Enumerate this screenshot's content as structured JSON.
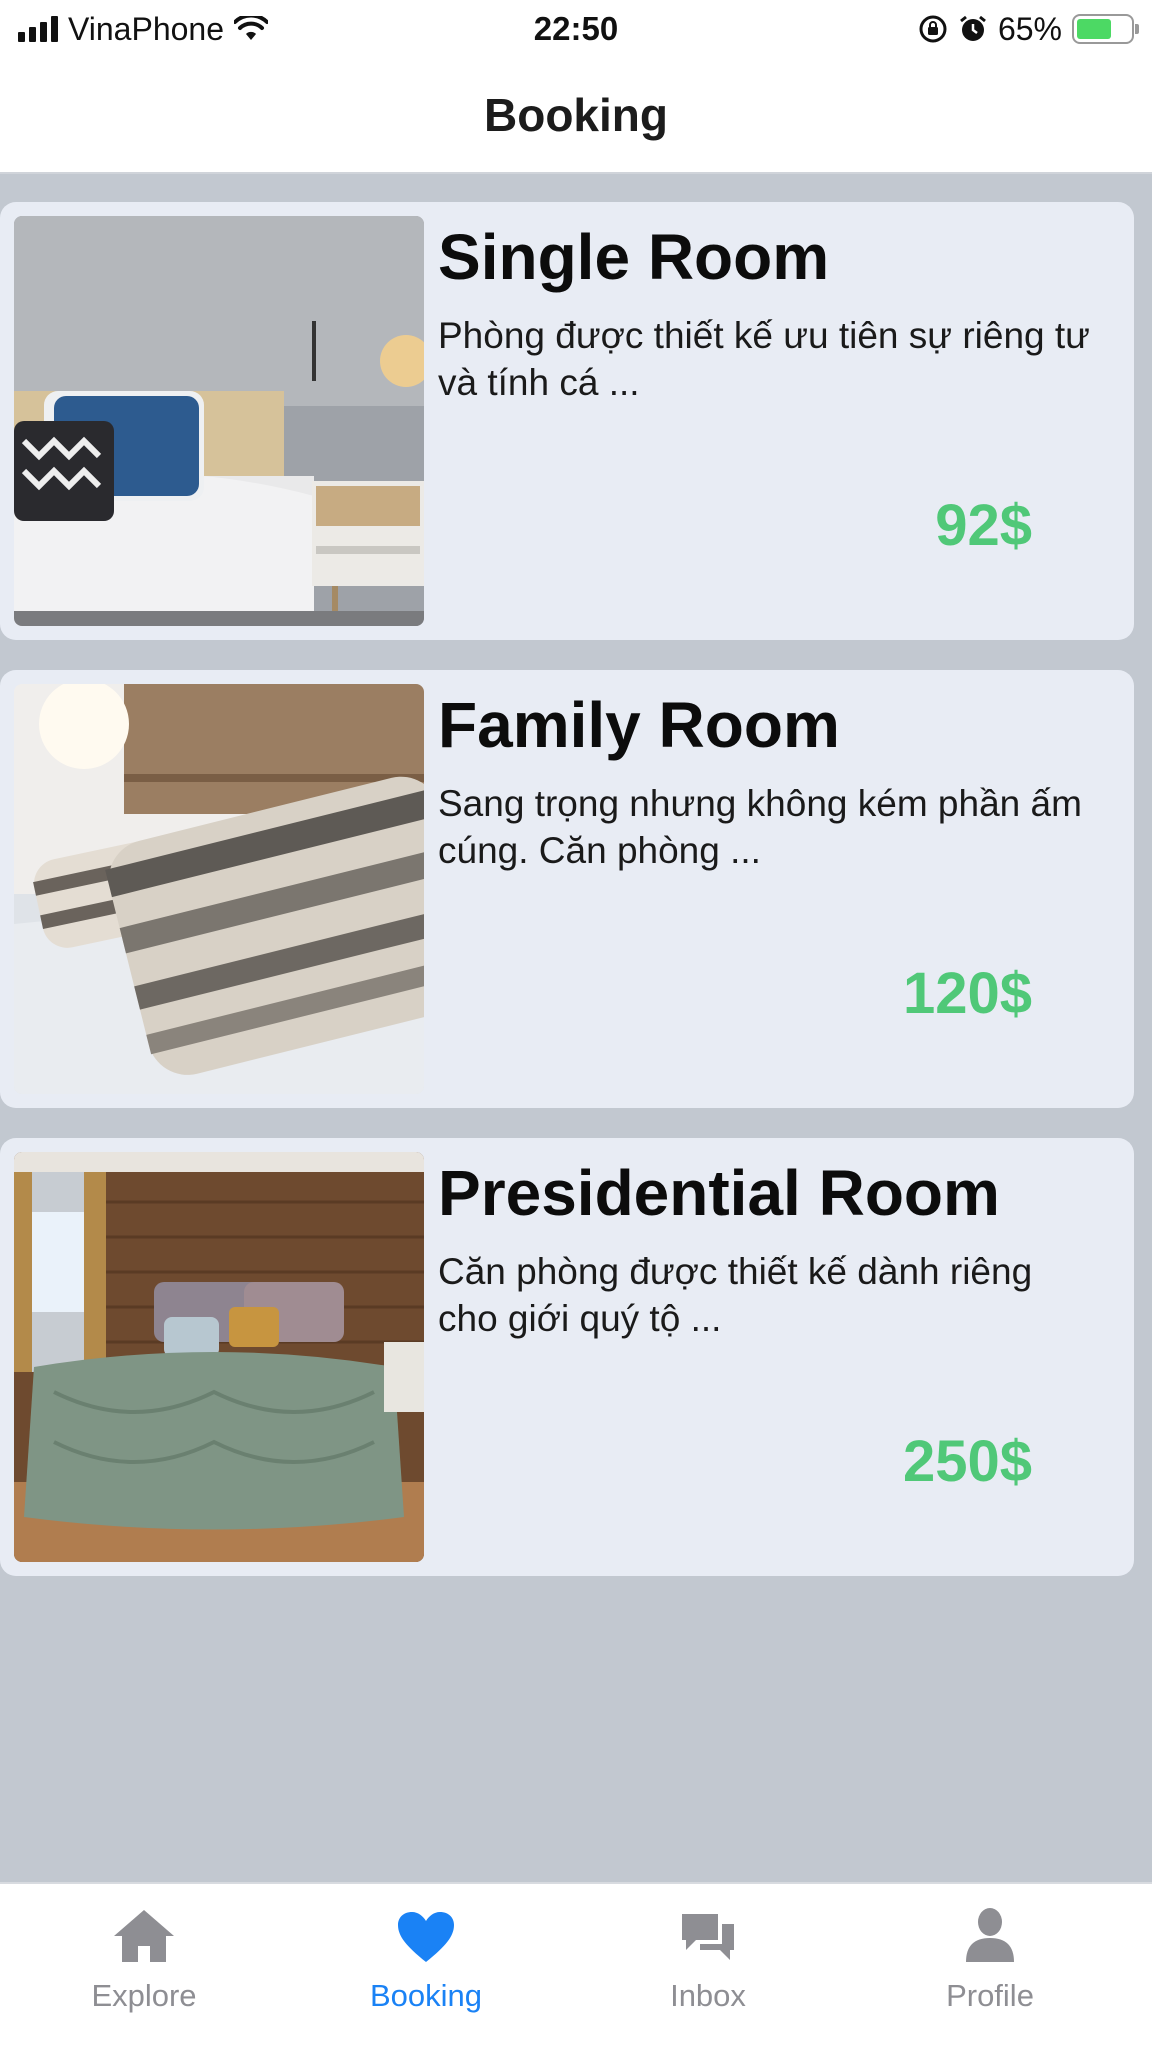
{
  "status_bar": {
    "carrier": "VinaPhone",
    "time": "22:50",
    "battery": "65%",
    "battery_level": 0.65,
    "icons": [
      "signal-icon",
      "wifi-icon",
      "rotation-lock-icon",
      "alarm-icon",
      "battery-charging-icon"
    ]
  },
  "header": {
    "title": "Booking"
  },
  "rooms": [
    {
      "title": "Single Room",
      "description": "Phòng được thiết kế ưu tiên sự riêng tư và tính cá ...",
      "price": "92$"
    },
    {
      "title": "Family Room",
      "description": "Sang trọng nhưng không kém phần ấm cúng. Căn phòng ...",
      "price": "120$"
    },
    {
      "title": "Presidential Room",
      "description": "Căn phòng được thiết kế dành riêng cho giới quý tộ ...",
      "price": "250$"
    }
  ],
  "tabs": [
    {
      "label": "Explore",
      "icon": "home-icon",
      "active": false
    },
    {
      "label": "Booking",
      "icon": "heart-icon",
      "active": true
    },
    {
      "label": "Inbox",
      "icon": "chat-icon",
      "active": false
    },
    {
      "label": "Profile",
      "icon": "user-icon",
      "active": false
    }
  ],
  "colors": {
    "price": "#50c878",
    "active_tab": "#1a82f5",
    "inactive_tab": "#8e8e93",
    "card_background": "#e8ecf4",
    "screen_background": "#c2c8d0"
  }
}
